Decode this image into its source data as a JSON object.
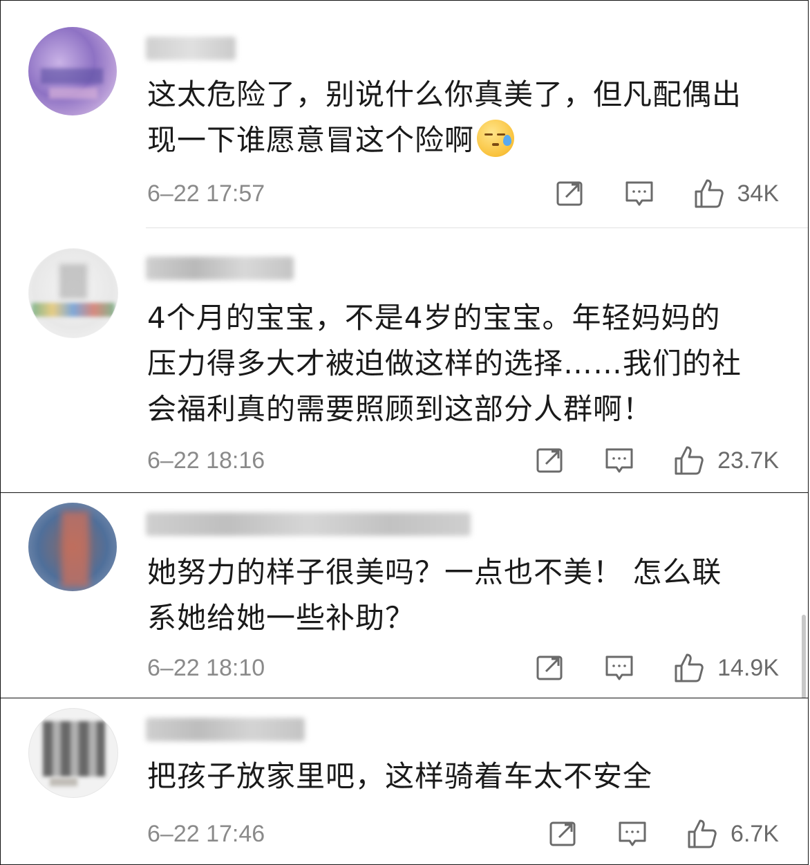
{
  "comments": [
    {
      "username": "",
      "text_lines": [
        "这太危险了，别说什么你真美了，但凡配偶出",
        "现一下谁愿意冒这个险啊"
      ],
      "emoji": "sleepy-sweat-emoji",
      "time": "6–22 17:57",
      "likes": "34K"
    },
    {
      "username": "",
      "text_lines": [
        "4个月的宝宝，不是4岁的宝宝。年轻妈妈的",
        "压力得多大才被迫做这样的选择……我们的社",
        "会福利真的需要照顾到这部分人群啊！"
      ],
      "time": "6–22 18:16",
      "likes": "23.7K"
    },
    {
      "username": "",
      "text_lines": [
        "她努力的样子很美吗？一点也不美！ 怎么联",
        "系她给她一些补助？"
      ],
      "time": "6–22 18:10",
      "likes": "14.9K"
    },
    {
      "username": "",
      "text_lines": [
        "把孩子放家里吧，这样骑着车太不安全"
      ],
      "time": "6–22 17:46",
      "likes": "6.7K"
    }
  ],
  "icons": {
    "repost": "share-icon",
    "comment": "comment-icon",
    "like": "thumbs-up-icon"
  },
  "colors": {
    "text": "#1a1a1a",
    "meta": "#8a8a8a",
    "icon": "#6a6a6a",
    "border": "#111111",
    "divider": "#e2e2e2"
  }
}
